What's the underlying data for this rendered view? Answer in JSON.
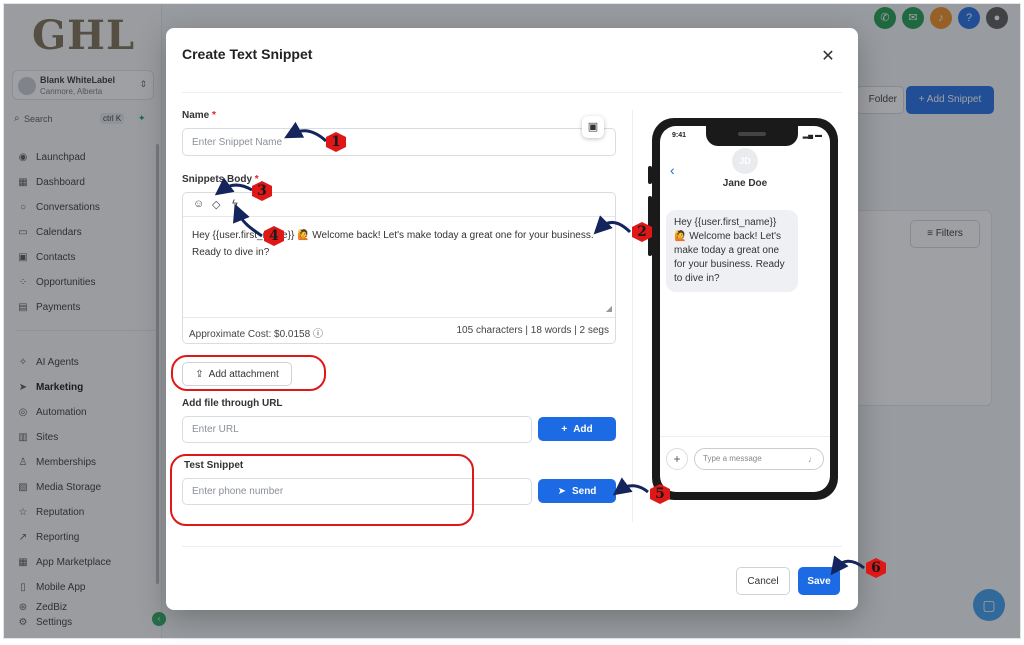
{
  "brand": "GHL",
  "account": {
    "name": "Blank WhiteLabel",
    "location": "Canmore, Alberta"
  },
  "search": {
    "label": "Search",
    "shortcut": "ctrl K"
  },
  "sidebar": {
    "items": [
      {
        "label": "Launchpad",
        "icon": "rocket-icon"
      },
      {
        "label": "Dashboard",
        "icon": "grid-icon"
      },
      {
        "label": "Conversations",
        "icon": "chat-icon"
      },
      {
        "label": "Calendars",
        "icon": "calendar-icon"
      },
      {
        "label": "Contacts",
        "icon": "contacts-icon"
      },
      {
        "label": "Opportunities",
        "icon": "opportunities-icon"
      },
      {
        "label": "Payments",
        "icon": "payments-icon"
      }
    ],
    "items2": [
      {
        "label": "AI Agents",
        "icon": "sparkle-icon"
      },
      {
        "label": "Marketing",
        "icon": "send-icon",
        "active": true
      },
      {
        "label": "Automation",
        "icon": "automation-icon"
      },
      {
        "label": "Sites",
        "icon": "sites-icon"
      },
      {
        "label": "Memberships",
        "icon": "memberships-icon"
      },
      {
        "label": "Media Storage",
        "icon": "media-icon"
      },
      {
        "label": "Reputation",
        "icon": "star-icon"
      },
      {
        "label": "Reporting",
        "icon": "reporting-icon"
      },
      {
        "label": "App Marketplace",
        "icon": "apps-icon"
      },
      {
        "label": "Mobile App",
        "icon": "mobile-icon"
      },
      {
        "label": "ZedBiz",
        "icon": "zedbiz-icon"
      },
      {
        "label": "Settings",
        "icon": "gear-icon"
      }
    ]
  },
  "background": {
    "folder_label": "Folder",
    "add_snippet_label": "+ Add Snippet",
    "filters_label": "Filters"
  },
  "modal": {
    "title": "Create Text Snippet",
    "name_label": "Name",
    "name_placeholder": "Enter Snippet Name",
    "body_label": "Snippets Body",
    "body_text": "Hey {{user.first_name}} 🙋 Welcome back! Let's make today a great one for your business. Ready to dive in?",
    "cost": "Approximate Cost: $0.0158",
    "stats": "105 characters | 18 words | 2 segs",
    "add_attachment": "Add attachment",
    "url_label": "Add file through URL",
    "url_placeholder": "Enter URL",
    "add_label": "Add",
    "test_label": "Test Snippet",
    "phone_placeholder": "Enter phone number",
    "send_label": "Send",
    "cancel_label": "Cancel",
    "save_label": "Save"
  },
  "phone_preview": {
    "time": "9:41",
    "avatar_initials": "JD",
    "contact_name": "Jane Doe",
    "message": "Hey {{user.first_name}} 🙋 Welcome back! Let's make today a great one for your business. Ready to dive in?",
    "input_placeholder": "Type a message"
  },
  "annotations": [
    "1",
    "2",
    "3",
    "4",
    "5",
    "6"
  ],
  "colors": {
    "primary": "#1c6ae4",
    "annotation": "#e01717"
  }
}
